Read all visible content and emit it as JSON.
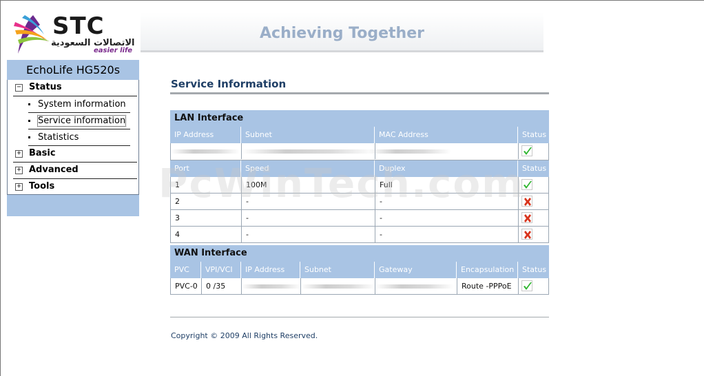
{
  "logo": {
    "brand": "STC",
    "arabic": "الاتصالات السعودية",
    "tagline": "easier life"
  },
  "banner": {
    "slogan": "Achieving Together"
  },
  "sidebar": {
    "device": "EchoLife HG520s",
    "menu": [
      {
        "label": "Status",
        "expanded": true,
        "toggle": "−"
      },
      {
        "label": "Basic",
        "expanded": false,
        "toggle": "+"
      },
      {
        "label": "Advanced",
        "expanded": false,
        "toggle": "+"
      },
      {
        "label": "Tools",
        "expanded": false,
        "toggle": "+"
      }
    ],
    "status_items": [
      {
        "label": "System information"
      },
      {
        "label": "Service information",
        "selected": true
      },
      {
        "label": "Statistics"
      }
    ]
  },
  "content": {
    "title": "Service Information",
    "lan": {
      "section": "LAN Interface",
      "ip_headers": {
        "ip": "IP Address",
        "subnet": "Subnet",
        "mac": "MAC Address",
        "status": "Status"
      },
      "ip_status": "ok",
      "port_headers": {
        "port": "Port",
        "speed": "Speed",
        "duplex": "Duplex",
        "status": "Status"
      },
      "ports": [
        {
          "port": "1",
          "speed": "100M",
          "duplex": "Full",
          "status": "ok"
        },
        {
          "port": "2",
          "speed": "-",
          "duplex": "-",
          "status": "bad"
        },
        {
          "port": "3",
          "speed": "-",
          "duplex": "-",
          "status": "bad"
        },
        {
          "port": "4",
          "speed": "-",
          "duplex": "-",
          "status": "bad"
        }
      ]
    },
    "wan": {
      "section": "WAN Interface",
      "headers": {
        "pvc": "PVC",
        "vpivci": "VPI/VCI",
        "ip": "IP Address",
        "subnet": "Subnet",
        "gateway": "Gateway",
        "encap": "Encapsulation",
        "status": "Status"
      },
      "rows": [
        {
          "pvc": "PVC-0",
          "vpivci": "0 /35",
          "encap": "Route -PPPoE",
          "status": "ok"
        }
      ]
    }
  },
  "footer": {
    "copyright": "Copyright © 2009 All Rights Reserved."
  },
  "watermark": "PcWinTech.com",
  "colors": {
    "header_blue": "#a9c4e4",
    "title_navy": "#1f3f66",
    "ok_green": "#2db52d",
    "bad_red": "#d8341c"
  }
}
